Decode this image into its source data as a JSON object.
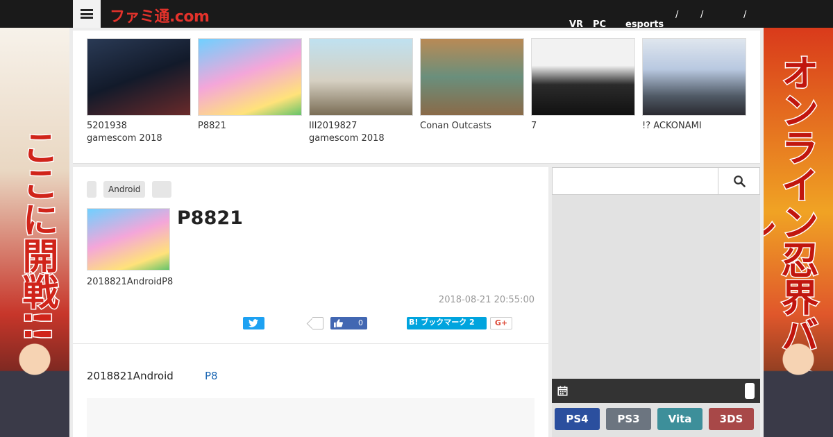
{
  "header": {
    "logo_text": "ファミ通.com",
    "nav": [
      "VR",
      "PC",
      "esports",
      "/",
      "/",
      "/"
    ]
  },
  "banners": {
    "left_text": "ここに開戦!!",
    "right_text": "オンライン忍界バトル"
  },
  "carousel": {
    "items": [
      {
        "caption": "5201938\ngamescom 2018"
      },
      {
        "caption": "P8821"
      },
      {
        "caption": "III2019827\ngamescom 2018"
      },
      {
        "caption": "Conan Outcasts"
      },
      {
        "caption": "7"
      },
      {
        "caption": "!? ACKONAMI"
      }
    ]
  },
  "article": {
    "tags": [
      "",
      "Android",
      ""
    ],
    "title": "P8821",
    "lead": "2018821AndroidP8",
    "date": "2018-08-21 20:55:00",
    "share": {
      "facebook_count": "0",
      "hatena_label": "B! ブックマーク 2",
      "gplus_label": "G+"
    },
    "body_text": "2018821Android",
    "body_link": "P8"
  },
  "sidebar": {
    "search_placeholder": "",
    "platforms": [
      {
        "label": "PS4",
        "color": "#2b4f9e"
      },
      {
        "label": "PS3",
        "color": "#6c7580"
      },
      {
        "label": "Vita",
        "color": "#3d8f9a"
      },
      {
        "label": "3DS",
        "color": "#a84848"
      }
    ]
  }
}
